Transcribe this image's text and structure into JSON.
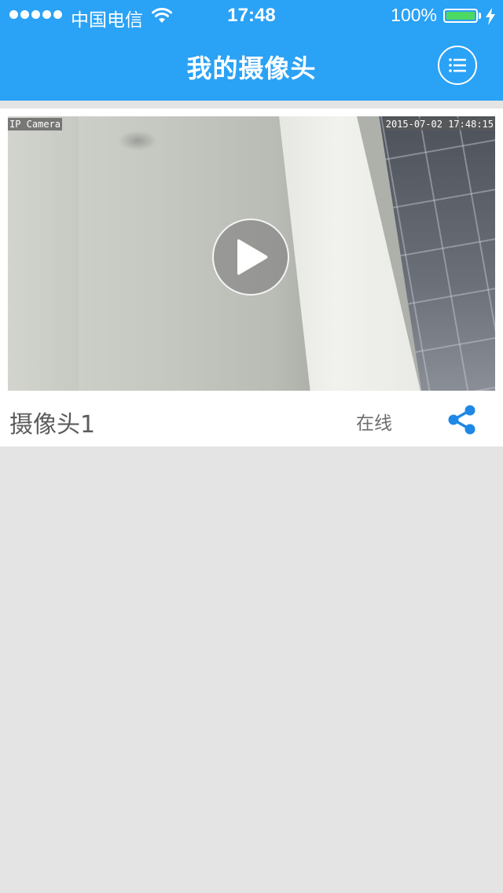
{
  "status_bar": {
    "carrier": "中国电信",
    "time": "17:48",
    "battery_percent": "100%"
  },
  "nav": {
    "title": "我的摄像头",
    "menu_icon": "list-icon"
  },
  "cameras": [
    {
      "name": "摄像头1",
      "status": "在线",
      "overlay_left": "IP Camera",
      "overlay_timestamp": "2015-07-02 17:48:15",
      "play_icon": "play-icon",
      "share_icon": "share-icon"
    }
  ],
  "colors": {
    "header": "#2aa2f6",
    "background": "#e4e4e4",
    "share_accent": "#1e88e5",
    "battery_fill": "#4cd964"
  }
}
